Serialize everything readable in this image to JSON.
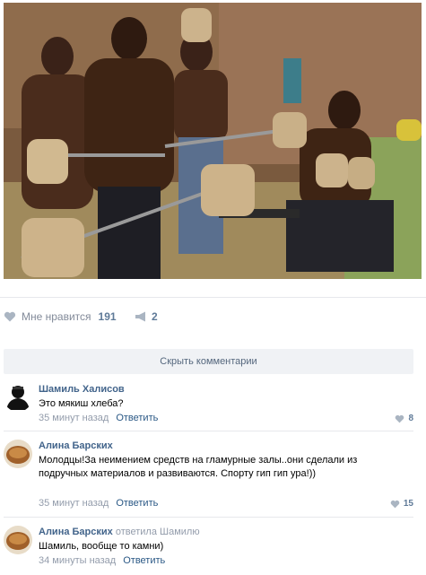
{
  "post": {
    "photo": "workout-photo",
    "likes_label": "Мне нравится",
    "likes_count": "191",
    "shares_count": "2"
  },
  "hide_comments": "Скрыть комментарии",
  "colors": {
    "link": "#42648b",
    "muted": "#939cab",
    "button_bg": "#f0f2f5"
  },
  "comments": [
    {
      "author": "Шамиль Халисов",
      "avatar_icon": "avatar-black-silhouette",
      "text": "Это мякиш хлеба?",
      "time": "35 минут назад",
      "reply_label": "Ответить",
      "likes": "8"
    },
    {
      "author": "Алина Барских",
      "avatar_icon": "avatar-bread",
      "text": "Молодцы!За неимением средств на гламурные залы..они сделали из подручных материалов и развиваются. Спорту гип гип ура!))",
      "time": "35 минут назад",
      "reply_label": "Ответить",
      "likes": "15"
    },
    {
      "author": "Алина Барских",
      "replied_to": "ответила Шамилю",
      "avatar_icon": "avatar-bread",
      "text": "Шамиль, вообще то камни)",
      "time": "34 минуты назад",
      "reply_label": "Ответить",
      "likes": ""
    }
  ]
}
